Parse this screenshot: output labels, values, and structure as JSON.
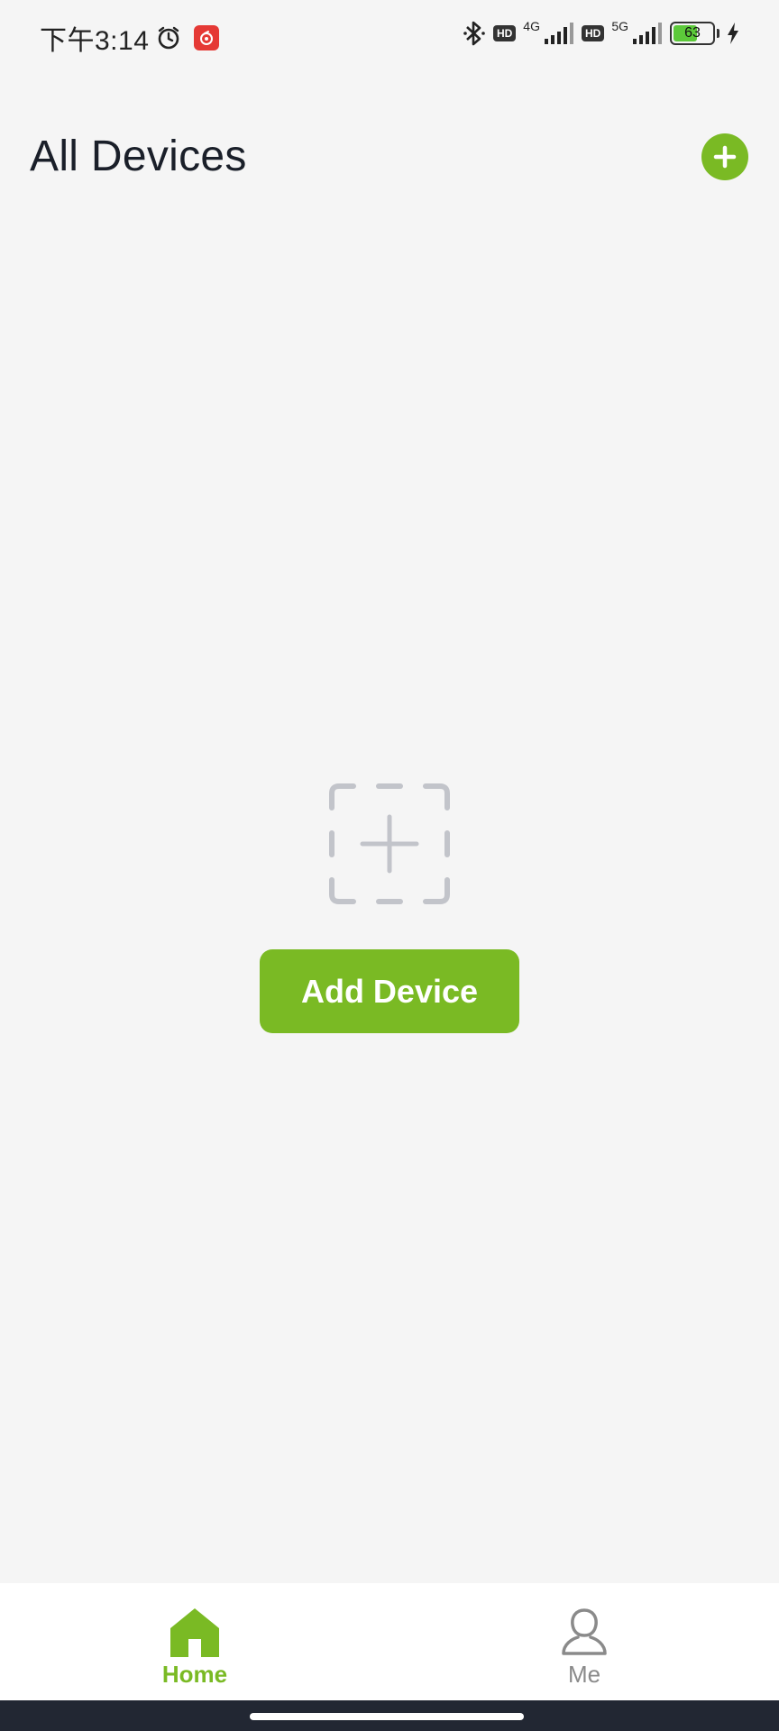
{
  "status_bar": {
    "time": "下午3:14",
    "network_1": "4G",
    "network_2": "5G",
    "hd_1": "HD",
    "hd_2": "HD",
    "battery_percent": "63",
    "battery_level": 0.63
  },
  "header": {
    "title": "All Devices"
  },
  "empty_state": {
    "add_button_label": "Add Device"
  },
  "bottom_nav": {
    "items": [
      {
        "label": "Home",
        "icon": "home-icon",
        "active": true
      },
      {
        "label": "Me",
        "icon": "person-icon",
        "active": false
      }
    ]
  },
  "colors": {
    "accent": "#7aba24",
    "background": "#f5f5f5",
    "text": "#1a1f29",
    "inactive": "#8a8a8a"
  }
}
